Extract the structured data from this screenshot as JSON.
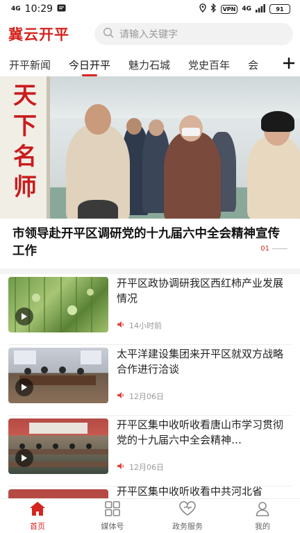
{
  "status_bar": {
    "network": "4G",
    "time": "10:29",
    "vpn": "VPN",
    "network_right": "4G",
    "battery": "91"
  },
  "header": {
    "logo": "冀云开平",
    "search_placeholder": "请输入关键字"
  },
  "tabs": [
    {
      "label": "开平新闻",
      "active": false
    },
    {
      "label": "今日开平",
      "active": true
    },
    {
      "label": "魅力石城",
      "active": false
    },
    {
      "label": "党史百年",
      "active": false
    },
    {
      "label": "会",
      "active": false
    }
  ],
  "hero": {
    "banner_chars": [
      "天",
      "下",
      "名",
      "师"
    ],
    "headline": "市领导赴开平区调研党的十九届六中全会精神宣传工作",
    "slide_indicator": "01"
  },
  "news": [
    {
      "title": "开平区政协调研我区西红柿产业发展情况",
      "time": "14小时前",
      "thumb": "tomato-greenhouse"
    },
    {
      "title": "太平洋建设集团来开平区就双方战略合作进行洽谈",
      "time": "12月06日",
      "thumb": "meeting-room"
    },
    {
      "title": "开平区集中收听收看唐山市学习贯彻党的十九届六中全会精神…",
      "time": "12月06日",
      "thumb": "conference-hall"
    },
    {
      "title": "开平区集中收听收看中共河北省",
      "time": "",
      "thumb": "conference-hall"
    }
  ],
  "bottom_nav": [
    {
      "label": "首页",
      "icon": "home-icon",
      "active": true
    },
    {
      "label": "媒体号",
      "icon": "grid-icon",
      "active": false
    },
    {
      "label": "政务服务",
      "icon": "heart-icon",
      "active": false
    },
    {
      "label": "我的",
      "icon": "user-icon",
      "active": false
    }
  ],
  "colors": {
    "accent": "#d6251f",
    "muted": "#999999"
  }
}
